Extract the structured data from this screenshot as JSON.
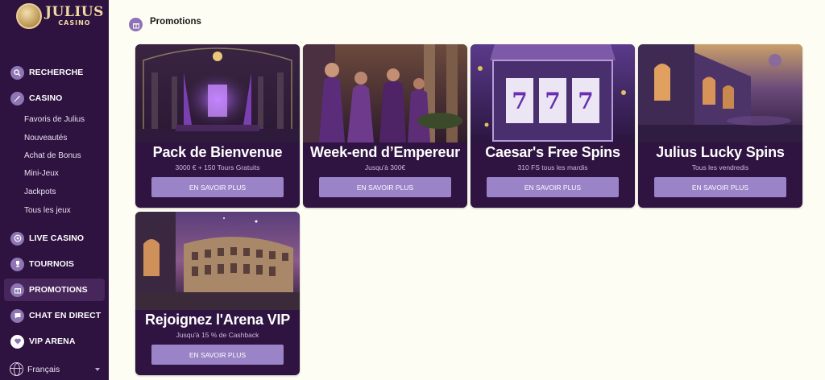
{
  "logo": {
    "title": "JULIUS",
    "subtitle": "CASINO"
  },
  "nav": {
    "search": "RECHERCHE",
    "casino": "CASINO",
    "casino_sub": [
      "Favoris de Julius",
      "Nouveautés",
      "Achat de Bonus",
      "Mini-Jeux",
      "Jackpots",
      "Tous les jeux"
    ],
    "live_casino": "LIVE CASINO",
    "tournaments": "TOURNOIS",
    "promotions": "PROMOTIONS",
    "chat": "CHAT EN DIRECT",
    "vip": "VIP ARENA"
  },
  "language": {
    "selected": "Français"
  },
  "page": {
    "title": "Promotions"
  },
  "promotions": [
    {
      "title": "Pack de Bienvenue",
      "subtitle": "3000 € + 150 Tours Gratuits",
      "button": "EN SAVOIR PLUS"
    },
    {
      "title": "Week-end d’Empereur",
      "subtitle": "Jusqu'à 300€",
      "button": "EN SAVOIR PLUS"
    },
    {
      "title": "Caesar's Free Spins",
      "subtitle": "310 FS tous les mardis",
      "button": "EN SAVOIR PLUS"
    },
    {
      "title": "Julius Lucky Spins",
      "subtitle": "Tous les vendredis",
      "button": "EN SAVOIR PLUS"
    },
    {
      "title": "Rejoignez l'Arena VIP",
      "subtitle": "Jusqu'à 15 % de Cashback",
      "button": "EN SAVOIR PLUS"
    }
  ],
  "icons": {
    "search": "search-icon",
    "casino": "rocket-icon",
    "live_casino": "chip-icon",
    "tournaments": "trophy-icon",
    "promotions": "gift-icon",
    "chat": "chat-icon",
    "vip": "heart-icon"
  },
  "colors": {
    "sidebar": "#2e1240",
    "accent": "#9a83c7",
    "page_bg": "#fdfdf3",
    "card_bg": "#2f1340"
  }
}
